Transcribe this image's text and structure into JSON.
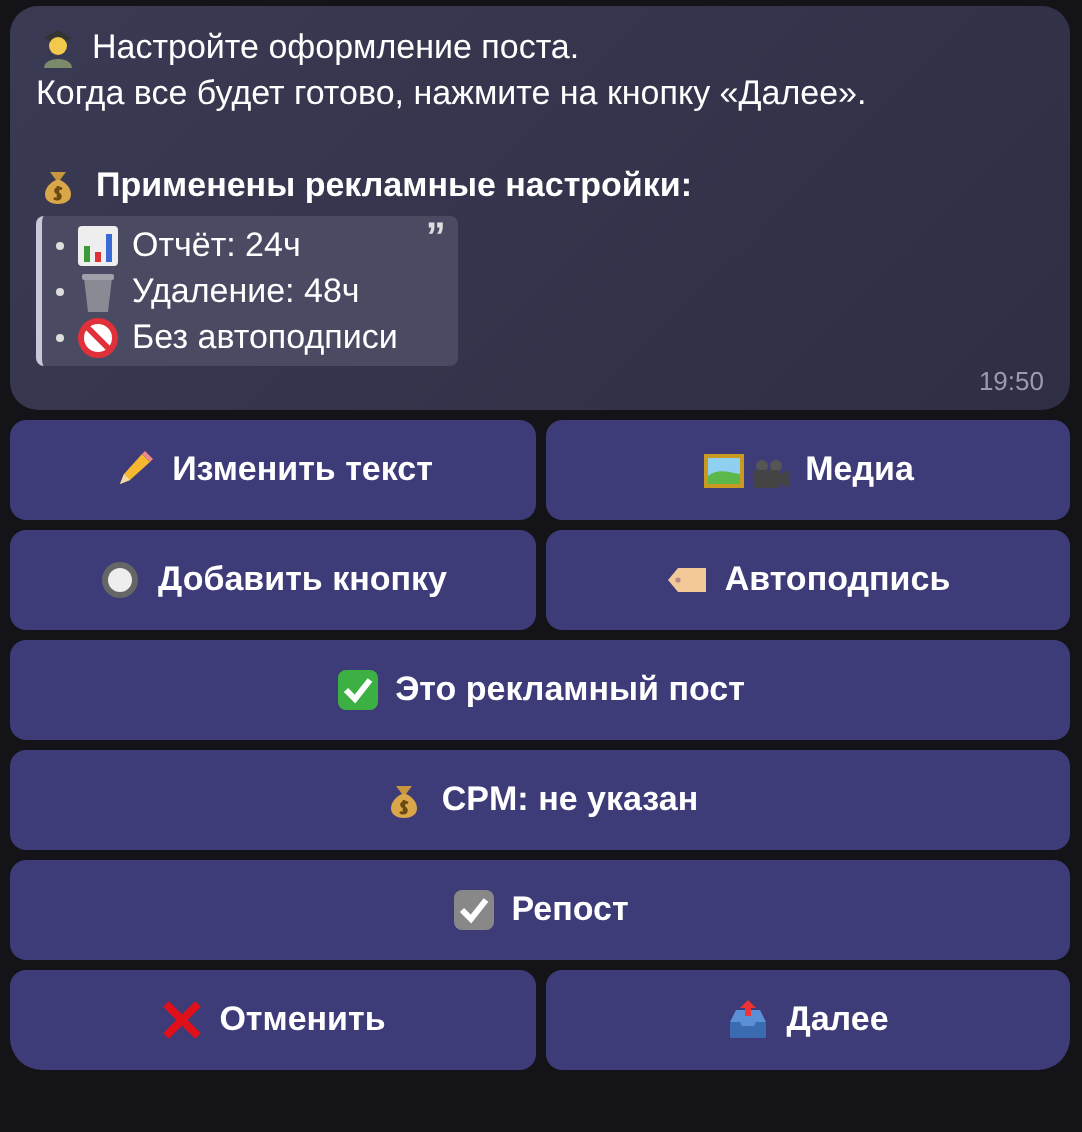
{
  "message": {
    "lines": [
      "Настройте оформление поста.",
      "Когда все будет готово, нажмите на кнопку «Далее»."
    ],
    "heading": "Применены рекламные настройки:",
    "quote": {
      "mark": "”",
      "items": [
        "Отчёт: 24ч",
        "Удаление: 48ч",
        "Без автоподписи"
      ]
    },
    "time": "19:50"
  },
  "keyboard": [
    {
      "buttons": [
        "Изменить текст",
        "Медиа"
      ]
    },
    {
      "buttons": [
        "Добавить кнопку",
        "Автоподпись"
      ]
    },
    {
      "buttons": [
        "Это рекламный пост"
      ]
    },
    {
      "buttons": [
        "CPM: не указан"
      ]
    },
    {
      "buttons": [
        "Репост"
      ]
    },
    {
      "buttons": [
        "Отменить",
        "Далее"
      ]
    }
  ]
}
